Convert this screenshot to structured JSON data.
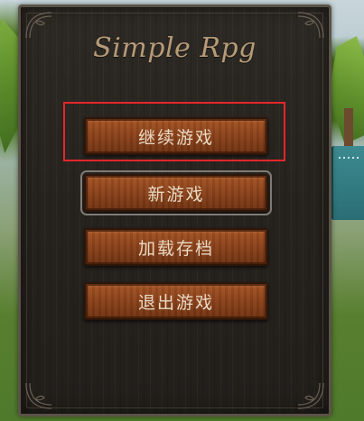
{
  "game": {
    "title": "Simple Rpg"
  },
  "menu": {
    "items": [
      {
        "label": "继续游戏",
        "selected": true
      },
      {
        "label": "新游戏",
        "hovered": true
      },
      {
        "label": "加载存档"
      },
      {
        "label": "退出游戏"
      }
    ]
  },
  "colors": {
    "panel": "#26221e",
    "button": "#8c421a",
    "title": "#b69b78",
    "selection_box": "#e4262a",
    "button_text": "#e8d9c3"
  }
}
